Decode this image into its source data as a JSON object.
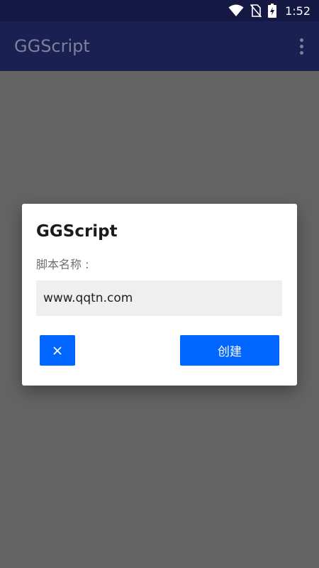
{
  "status_bar": {
    "time": "1:52",
    "icons": [
      "wifi-icon",
      "no-sim-icon",
      "battery-charging-icon"
    ]
  },
  "app_bar": {
    "title": "GGScript",
    "menu_icon": "overflow-menu-icon"
  },
  "dialog": {
    "title": "GGScript",
    "field_label": "脚本名称 :",
    "field_value": "www.qqtn.com",
    "cancel_icon": "close-icon",
    "create_label": "创建"
  },
  "colors": {
    "status_bar": "#141843",
    "app_bar": "#1a2052",
    "scrim": "#646464",
    "accent": "#0066ff",
    "input_bg": "#efefef"
  }
}
